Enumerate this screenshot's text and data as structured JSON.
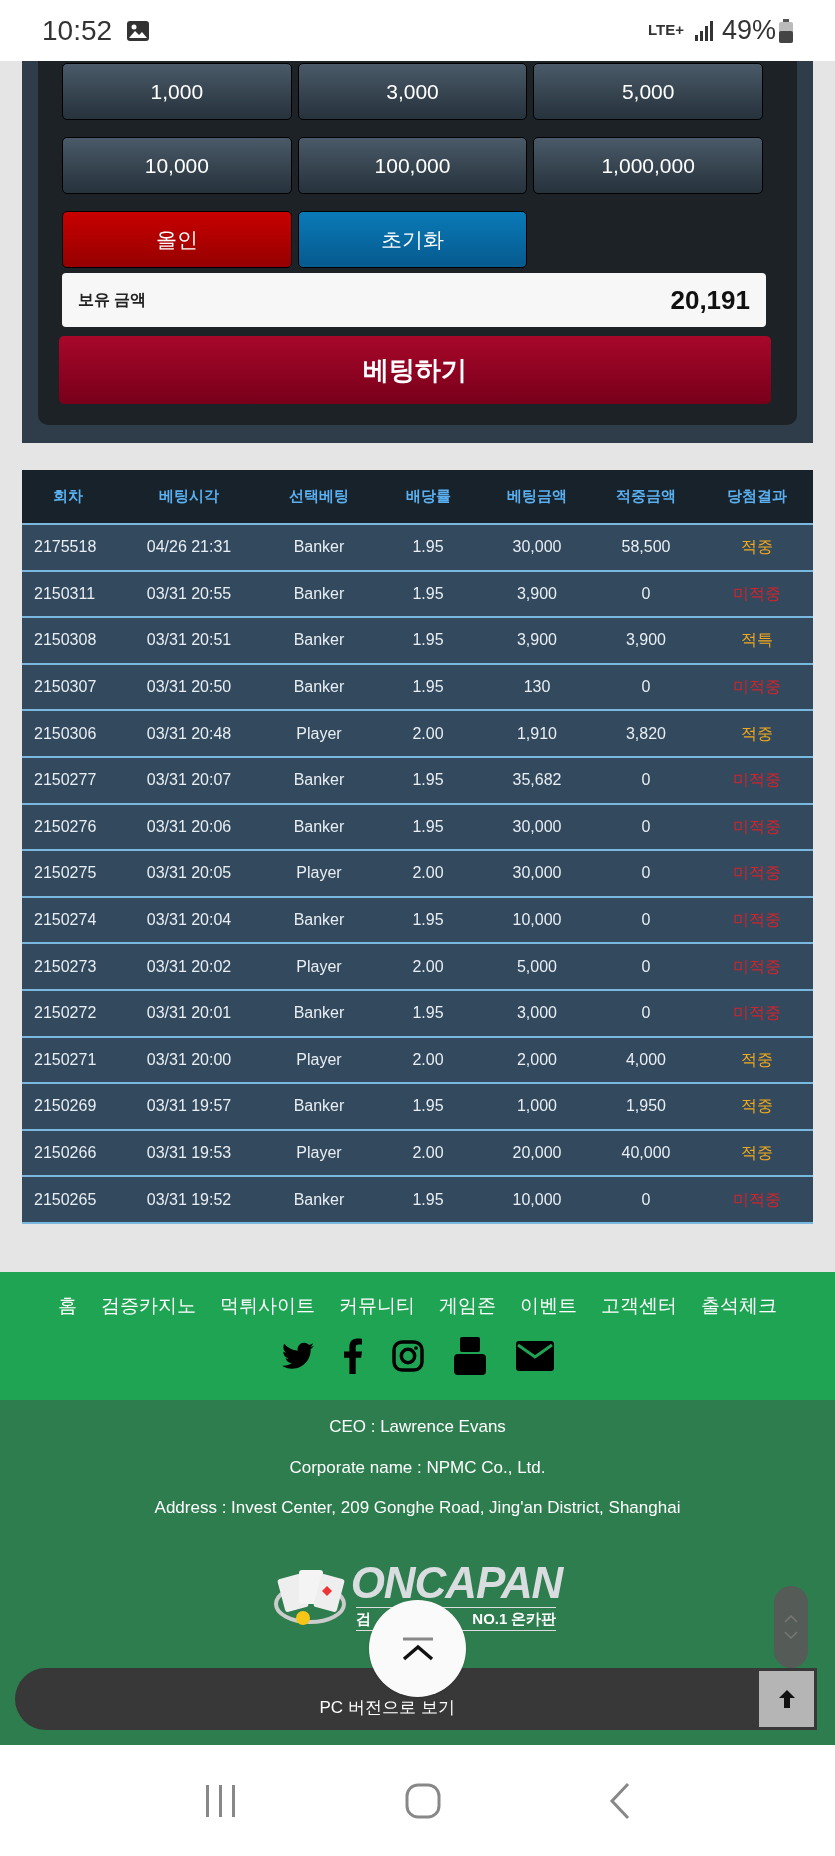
{
  "status_bar": {
    "time": "10:52",
    "network": "LTE+",
    "battery": "49%"
  },
  "chip_buttons": [
    "1,000",
    "3,000",
    "5,000",
    "10,000",
    "100,000",
    "1,000,000"
  ],
  "action_buttons": [
    {
      "label": "올인",
      "kind": "allin"
    },
    {
      "label": "초기화",
      "kind": "reset"
    }
  ],
  "balance": {
    "label": "보유 금액",
    "value": "20,191"
  },
  "bet_button": "베팅하기",
  "table": {
    "columns": [
      "회차",
      "베팅시각",
      "선택베팅",
      "배당률",
      "베팅금액",
      "적중금액",
      "당첨결과"
    ],
    "rows": [
      {
        "cells": [
          "2175518",
          "04/26 21:31",
          "Banker",
          "1.95",
          "30,000",
          "58,500",
          "적중"
        ],
        "kind": "hit"
      },
      {
        "cells": [
          "2150311",
          "03/31 20:55",
          "Banker",
          "1.95",
          "3,900",
          "0",
          "미적중"
        ],
        "kind": "miss"
      },
      {
        "cells": [
          "2150308",
          "03/31 20:51",
          "Banker",
          "1.95",
          "3,900",
          "3,900",
          "적특"
        ],
        "kind": "hit"
      },
      {
        "cells": [
          "2150307",
          "03/31 20:50",
          "Banker",
          "1.95",
          "130",
          "0",
          "미적중"
        ],
        "kind": "miss"
      },
      {
        "cells": [
          "2150306",
          "03/31 20:48",
          "Player",
          "2.00",
          "1,910",
          "3,820",
          "적중"
        ],
        "kind": "hit"
      },
      {
        "cells": [
          "2150277",
          "03/31 20:07",
          "Banker",
          "1.95",
          "35,682",
          "0",
          "미적중"
        ],
        "kind": "miss"
      },
      {
        "cells": [
          "2150276",
          "03/31 20:06",
          "Banker",
          "1.95",
          "30,000",
          "0",
          "미적중"
        ],
        "kind": "miss"
      },
      {
        "cells": [
          "2150275",
          "03/31 20:05",
          "Player",
          "2.00",
          "30,000",
          "0",
          "미적중"
        ],
        "kind": "miss"
      },
      {
        "cells": [
          "2150274",
          "03/31 20:04",
          "Banker",
          "1.95",
          "10,000",
          "0",
          "미적중"
        ],
        "kind": "miss"
      },
      {
        "cells": [
          "2150273",
          "03/31 20:02",
          "Player",
          "2.00",
          "5,000",
          "0",
          "미적중"
        ],
        "kind": "miss"
      },
      {
        "cells": [
          "2150272",
          "03/31 20:01",
          "Banker",
          "1.95",
          "3,000",
          "0",
          "미적중"
        ],
        "kind": "miss"
      },
      {
        "cells": [
          "2150271",
          "03/31 20:00",
          "Player",
          "2.00",
          "2,000",
          "4,000",
          "적중"
        ],
        "kind": "hit"
      },
      {
        "cells": [
          "2150269",
          "03/31 19:57",
          "Banker",
          "1.95",
          "1,000",
          "1,950",
          "적중"
        ],
        "kind": "hit"
      },
      {
        "cells": [
          "2150266",
          "03/31 19:53",
          "Player",
          "2.00",
          "20,000",
          "40,000",
          "적중"
        ],
        "kind": "hit"
      },
      {
        "cells": [
          "2150265",
          "03/31 19:52",
          "Banker",
          "1.95",
          "10,000",
          "0",
          "미적중"
        ],
        "kind": "miss"
      }
    ]
  },
  "footer_nav": [
    "홈",
    "검증카지노",
    "먹튀사이트",
    "커뮤니티",
    "게임존",
    "이벤트",
    "고객센터",
    "출석체크"
  ],
  "company_info": [
    "CEO : Lawrence Evans",
    "Corporate name : NPMC Co., Ltd.",
    "Address : Invest Center, 209 Gonghe Road, Jing'an District, Shanghai"
  ],
  "logo": {
    "name": "ONCAPAN",
    "tagline_start": "검",
    "tagline_end": "NO.1 온카판"
  },
  "pc_version_bar": "PC 버전으로 보기"
}
